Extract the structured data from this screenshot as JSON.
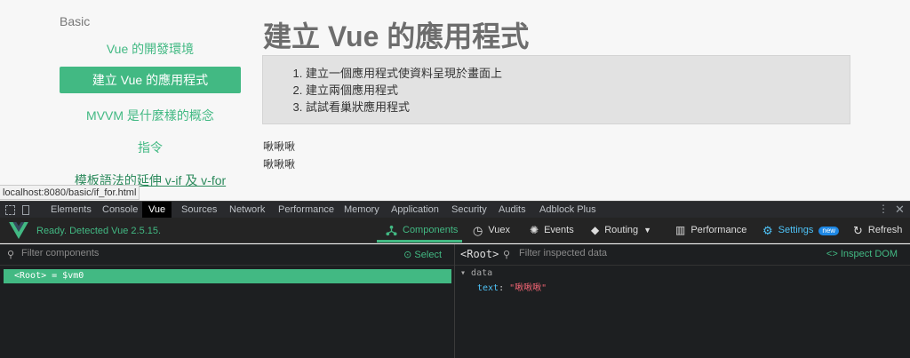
{
  "sidebar": {
    "section_title": "Basic",
    "items": [
      {
        "label": "Vue 的開發環境"
      },
      {
        "label": "建立 Vue 的應用程式"
      },
      {
        "label": "MVVM 是什麼樣的概念"
      },
      {
        "label": "指令"
      },
      {
        "label": "模板語法的延伸 v-if 及 v-for"
      }
    ]
  },
  "main": {
    "title": "建立 Vue 的應用程式",
    "notes": [
      "建立一個應用程式使資料呈現於畫面上",
      "建立兩個應用程式",
      "試試看巢狀應用程式"
    ],
    "outputs": [
      "啾啾啾",
      "啾啾啾"
    ]
  },
  "status_url": "localhost:8080/basic/if_for.html",
  "devtools": {
    "tabs": [
      "Elements",
      "Console",
      "Vue",
      "Sources",
      "Network",
      "Performance",
      "Memory",
      "Application",
      "Security",
      "Audits",
      "Adblock Plus"
    ],
    "active_tab": "Vue"
  },
  "vue_header": {
    "status": "Ready. Detected Vue 2.5.15.",
    "nav": [
      {
        "label": "Components",
        "icon": "components-icon"
      },
      {
        "label": "Vuex",
        "icon": "history-icon"
      },
      {
        "label": "Events",
        "icon": "events-icon"
      },
      {
        "label": "Routing",
        "icon": "routing-icon"
      },
      {
        "label": "Performance",
        "icon": "performance-icon"
      },
      {
        "label": "Settings",
        "icon": "settings-icon"
      },
      {
        "label": "Refresh",
        "icon": "refresh-icon"
      }
    ],
    "new_badge": "new",
    "accent": "#42b983"
  },
  "components_panel": {
    "filter_placeholder": "Filter components",
    "select_label": "Select",
    "root_item": "<Root> = $vm0"
  },
  "inspector": {
    "selected": "<Root>",
    "filter_placeholder": "Filter inspected data",
    "inspect_dom": "Inspect DOM",
    "section": "data",
    "props": [
      {
        "key": "text",
        "value": "\"啾啾啾\""
      }
    ]
  }
}
